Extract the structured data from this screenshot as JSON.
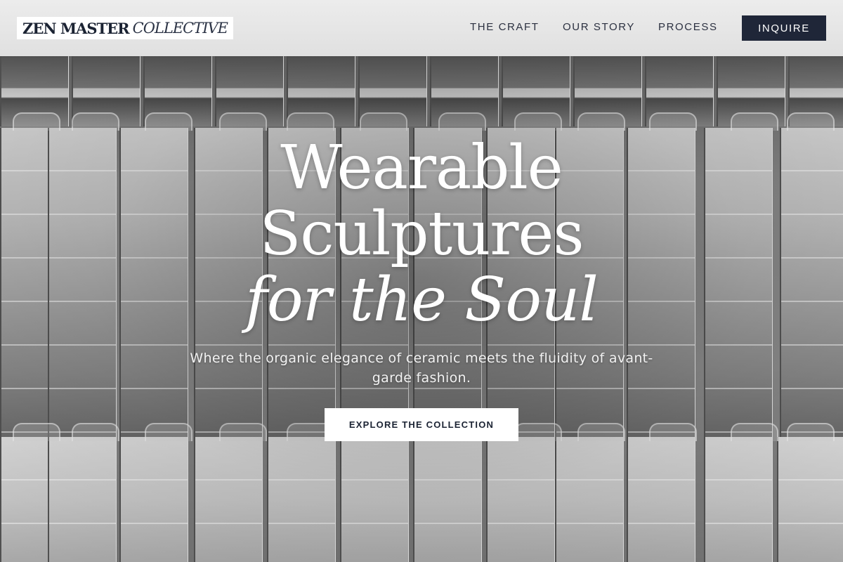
{
  "header": {
    "logo_main": "ZEN MASTER",
    "logo_sub": "COLLECTIVE",
    "nav": [
      {
        "label": "THE CRAFT"
      },
      {
        "label": "OUR STORY"
      },
      {
        "label": "PROCESS"
      }
    ],
    "cta_label": "INQUIRE"
  },
  "hero": {
    "title_line_1": "Wearable",
    "title_line_2": "Sculptures",
    "title_line_3": "for the Soul",
    "subtitle": "Where the organic elegance of ceramic meets the fluidity of avant-garde fashion.",
    "cta_label": "EXPLORE THE COLLECTION"
  },
  "colors": {
    "brand_dark": "#1f2638",
    "header_bg": "#e6e6e6",
    "hero_text": "#ffffff",
    "cta_bg": "#ffffff"
  }
}
